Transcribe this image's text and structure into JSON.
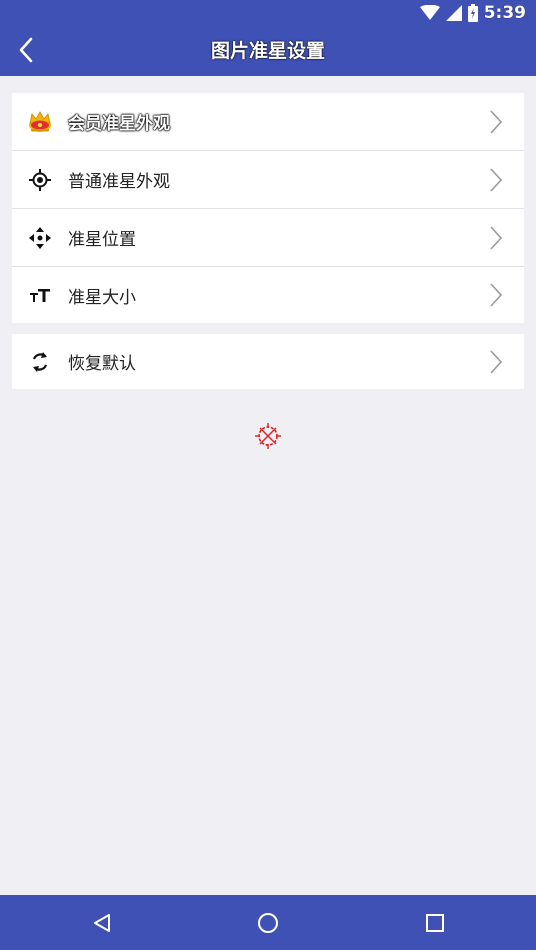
{
  "status_bar": {
    "time": "5:39",
    "icons": [
      "wifi-icon",
      "signal-icon",
      "battery-icon"
    ]
  },
  "app_bar": {
    "title": "图片准星设置",
    "back_icon": "chevron-left-icon",
    "background": "#3f51b5"
  },
  "settings": {
    "groups": [
      {
        "items": [
          {
            "label": "会员准星外观",
            "icon": "crown-icon"
          },
          {
            "label": "普通准星外观",
            "icon": "crosshair-target-icon"
          },
          {
            "label": "准星位置",
            "icon": "move-arrows-icon"
          },
          {
            "label": "准星大小",
            "icon": "text-size-icon"
          }
        ]
      },
      {
        "items": [
          {
            "label": "恢复默认",
            "icon": "refresh-icon"
          }
        ]
      }
    ]
  },
  "preview": {
    "icon": "crosshair-preview-icon",
    "color": "#e02020"
  },
  "nav_bar": {
    "buttons": [
      "back-triangle-icon",
      "home-circle-icon",
      "recents-square-icon"
    ]
  }
}
